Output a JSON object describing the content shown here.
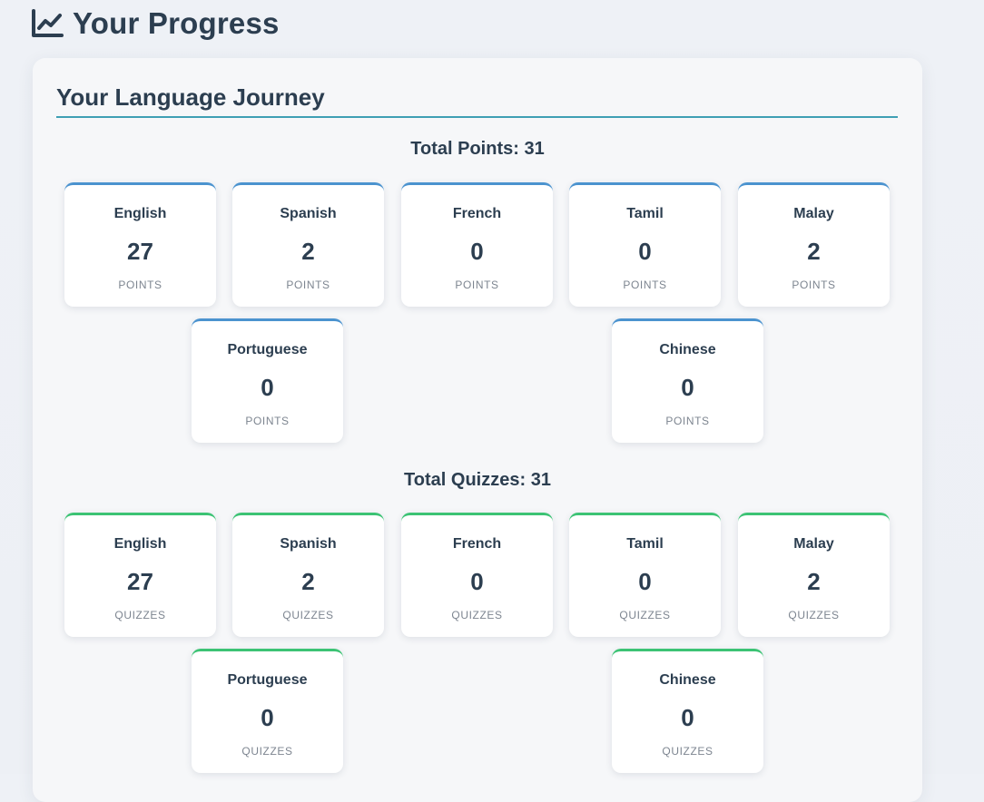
{
  "header": {
    "title": "Your Progress",
    "icon": "line-chart-icon"
  },
  "journey": {
    "title": "Your Language Journey",
    "points": {
      "label": "Total Points:",
      "total": "31",
      "unit": "POINTS",
      "items": [
        {
          "lang": "English",
          "value": "27"
        },
        {
          "lang": "Spanish",
          "value": "2"
        },
        {
          "lang": "French",
          "value": "0"
        },
        {
          "lang": "Tamil",
          "value": "0"
        },
        {
          "lang": "Malay",
          "value": "2"
        },
        {
          "lang": "Portuguese",
          "value": "0"
        },
        {
          "lang": "Chinese",
          "value": "0"
        }
      ]
    },
    "quizzes": {
      "label": "Total Quizzes:",
      "total": "31",
      "unit": "QUIZZES",
      "items": [
        {
          "lang": "English",
          "value": "27"
        },
        {
          "lang": "Spanish",
          "value": "2"
        },
        {
          "lang": "French",
          "value": "0"
        },
        {
          "lang": "Tamil",
          "value": "0"
        },
        {
          "lang": "Malay",
          "value": "2"
        },
        {
          "lang": "Portuguese",
          "value": "0"
        },
        {
          "lang": "Chinese",
          "value": "0"
        }
      ]
    }
  },
  "colors": {
    "points_accent": "#4b93cf",
    "quizzes_accent": "#3cc374",
    "title_rule": "#3f9fb4"
  }
}
